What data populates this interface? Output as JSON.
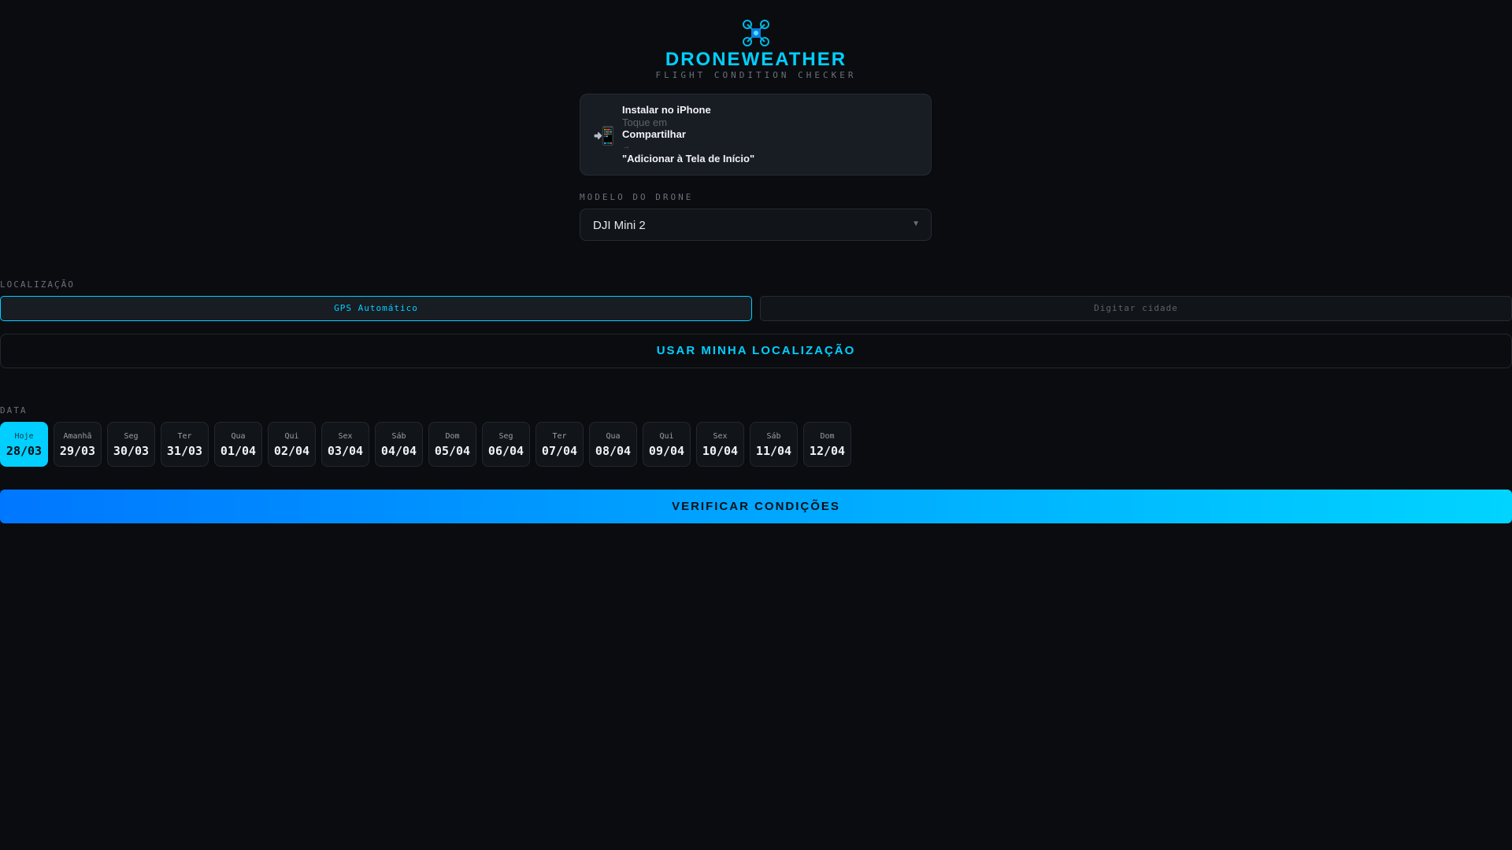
{
  "header": {
    "title": "DRONEWEATHER",
    "subtitle": "FLIGHT CONDITION CHECKER"
  },
  "install": {
    "title": "Instalar no iPhone",
    "line1": "Toque em",
    "line2": "Compartilhar",
    "arrow": "→",
    "line3": "\"Adicionar à Tela de Início\""
  },
  "drone": {
    "label": "MODELO DO DRONE",
    "selected": "DJI Mini 2"
  },
  "location": {
    "label": "LOCALIZAÇÃO",
    "gps": "GPS Automático",
    "city": "Digitar cidade",
    "use_button": "USAR MINHA LOCALIZAÇÃO"
  },
  "date": {
    "label": "DATA",
    "items": [
      {
        "day": "Hoje",
        "date": "28/03"
      },
      {
        "day": "Amanhã",
        "date": "29/03"
      },
      {
        "day": "Seg",
        "date": "30/03"
      },
      {
        "day": "Ter",
        "date": "31/03"
      },
      {
        "day": "Qua",
        "date": "01/04"
      },
      {
        "day": "Qui",
        "date": "02/04"
      },
      {
        "day": "Sex",
        "date": "03/04"
      },
      {
        "day": "Sáb",
        "date": "04/04"
      },
      {
        "day": "Dom",
        "date": "05/04"
      },
      {
        "day": "Seg",
        "date": "06/04"
      },
      {
        "day": "Ter",
        "date": "07/04"
      },
      {
        "day": "Qua",
        "date": "08/04"
      },
      {
        "day": "Qui",
        "date": "09/04"
      },
      {
        "day": "Sex",
        "date": "10/04"
      },
      {
        "day": "Sáb",
        "date": "11/04"
      },
      {
        "day": "Dom",
        "date": "12/04"
      }
    ]
  },
  "verify_button": "VERIFICAR CONDIÇÕES",
  "colors": {
    "accent": "#00cfff",
    "background": "#0a0c10"
  }
}
